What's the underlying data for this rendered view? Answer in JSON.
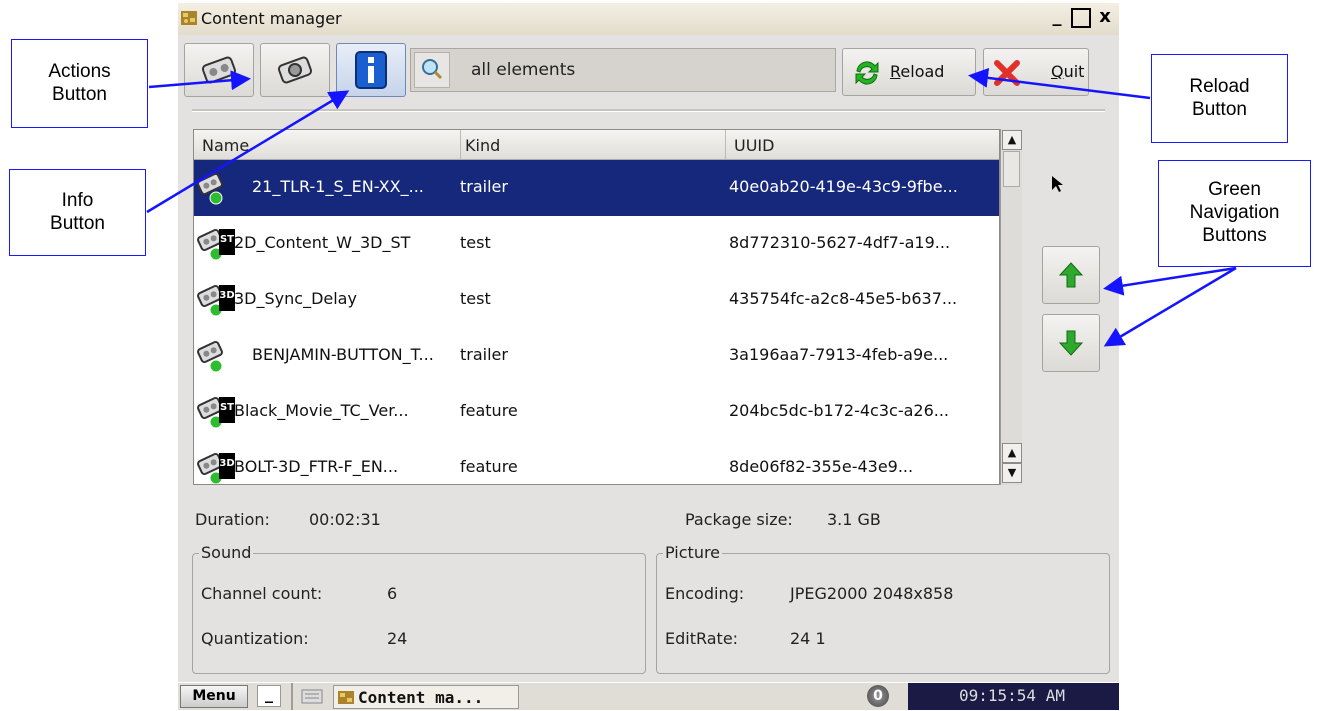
{
  "window": {
    "title": "Content manager",
    "minimize": "_",
    "maximize": "□",
    "close": "x"
  },
  "toolbar": {
    "search_value": "all elements",
    "reload_label": "Reload",
    "reload_mnemonic": "R",
    "reload_rest": "eload",
    "quit_label": "Quit",
    "quit_mnemonic": "Q",
    "quit_rest": "uit"
  },
  "list": {
    "columns": [
      "Name",
      "Kind",
      "UUID"
    ],
    "rows": [
      {
        "name": "21_TLR-1_S_EN-XX_...",
        "kind": "trailer",
        "uuid": "40e0ab20-419e-43c9-9fbe...",
        "badge": "",
        "selected": true
      },
      {
        "name": "2D_Content_W_3D_ST",
        "kind": "test",
        "uuid": "8d772310-5627-4df7-a19...",
        "badge": "ST",
        "selected": false
      },
      {
        "name": "3D_Sync_Delay",
        "kind": "test",
        "uuid": "435754fc-a2c8-45e5-b637...",
        "badge": "3D",
        "selected": false
      },
      {
        "name": "BENJAMIN-BUTTON_T...",
        "kind": "trailer",
        "uuid": "3a196aa7-7913-4feb-a9e...",
        "badge": "",
        "selected": false
      },
      {
        "name": "Black_Movie_TC_Ver...",
        "kind": "feature",
        "uuid": "204bc5dc-b172-4c3c-a26...",
        "badge": "ST",
        "selected": false
      },
      {
        "name": "BOLT-3D_FTR-F_EN...",
        "kind": "feature",
        "uuid": "8de06f82-355e-43e9...",
        "badge": "3D",
        "selected": false
      }
    ]
  },
  "details": {
    "duration_label": "Duration:",
    "duration_value": "00:02:31",
    "package_label": "Package size:",
    "package_value": "3.1 GB",
    "sound": {
      "title": "Sound",
      "channel_label": "Channel count:",
      "channel_value": "6",
      "quant_label": "Quantization:",
      "quant_value": "24"
    },
    "picture": {
      "title": "Picture",
      "encoding_label": "Encoding:",
      "encoding_value": "JPEG2000 2048x858",
      "editrate_label": "EditRate:",
      "editrate_value": "24 1"
    }
  },
  "taskbar": {
    "menu": "Menu",
    "min_icon": "_",
    "task_label": "Content ma...",
    "tray_badge": "0",
    "clock": "09:15:54 AM"
  },
  "callouts": {
    "actions": "Actions\nButton",
    "info": "Info\nButton",
    "reload": "Reload\nButton",
    "nav": "Green\nNavigation\nButtons"
  },
  "colors": {
    "selection": "#16287b",
    "callout_border": "#1a1aff",
    "nav_arrow": "#2fa82f",
    "clock_bg": "#1a1a45"
  }
}
